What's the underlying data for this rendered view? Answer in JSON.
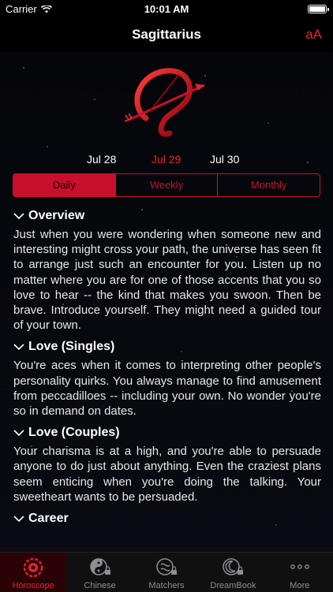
{
  "status": {
    "carrier": "Carrier",
    "time": "10:01 AM"
  },
  "nav": {
    "title": "Sagittarius",
    "font_button": "aA"
  },
  "dates": [
    "Jul 28",
    "Jul 29",
    "Jul 30"
  ],
  "selected_date": "Jul 29",
  "segments": [
    "Daily",
    "Weekly",
    "Monthly"
  ],
  "selected_segment": "Daily",
  "sections": [
    {
      "title": "Overview",
      "body": "Just when you were wondering when someone new and interesting might cross your path, the universe has seen fit to arrange just such an encounter for you. Listen up no matter where you are for one of those accents that you so love to hear -- the kind that makes you swoon. Then be brave. Introduce yourself. They might need a guided tour of your town."
    },
    {
      "title": "Love (Singles)",
      "body": "You're aces when it comes to interpreting other people's personality quirks. You always manage to find amusement from peccadilloes -- including your own. No wonder you're so in demand on dates."
    },
    {
      "title": "Love (Couples)",
      "body": "Your charisma is at a high, and you're able to persuade anyone to do just about anything. Even the craziest plans seem enticing when you're doing the talking. Your sweetheart wants to be persuaded."
    },
    {
      "title": "Career",
      "body": ""
    }
  ],
  "tabs": [
    {
      "label": "Horoscope",
      "icon": "wheel-icon"
    },
    {
      "label": "Chinese",
      "icon": "yin-yang-icon"
    },
    {
      "label": "Matchers",
      "icon": "matchers-icon"
    },
    {
      "label": "DreamBook",
      "icon": "moon-icon"
    },
    {
      "label": "More",
      "icon": "more-icon"
    }
  ],
  "colors": {
    "accent": "#e3232d",
    "segment": "#c8102e",
    "background": "#000000"
  }
}
